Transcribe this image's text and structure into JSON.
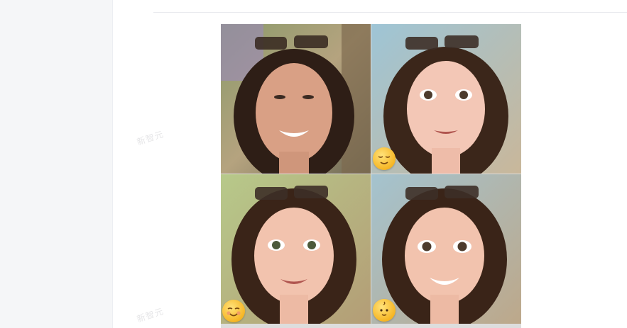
{
  "page": {
    "watermark_text": "新智元"
  },
  "collage": {
    "tiles": [
      {
        "style": "photo",
        "emoji": ""
      },
      {
        "style": "cartoon",
        "emoji": "relieved-face"
      },
      {
        "style": "cartoon",
        "emoji": "smiling-face"
      },
      {
        "style": "cartoon",
        "emoji": "baby-face"
      }
    ]
  },
  "colors": {
    "sidebar_bg": "#f5f6f8",
    "divider": "#e9eaee",
    "emoji_yellow": "#f6b625"
  }
}
